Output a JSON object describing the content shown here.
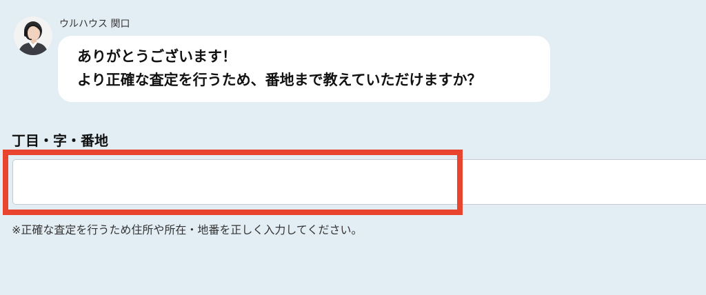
{
  "agent": {
    "name": "ウルハウス 関口",
    "avatar_icon": "operator-headset-avatar-icon"
  },
  "message": {
    "line1": "ありがとうございます！",
    "line2": "より正確な査定を行うため、番地まで教えていただけますか？"
  },
  "form": {
    "label": "丁目・字・番地",
    "input_value": "",
    "input_placeholder": "",
    "hint": "※正確な査定を行うため住所や所在・地番を正しく入力してください。"
  },
  "colors": {
    "background": "#e2eef4",
    "bubble": "#ffffff",
    "highlight": "#e8442e",
    "input_border": "#c6cace"
  }
}
